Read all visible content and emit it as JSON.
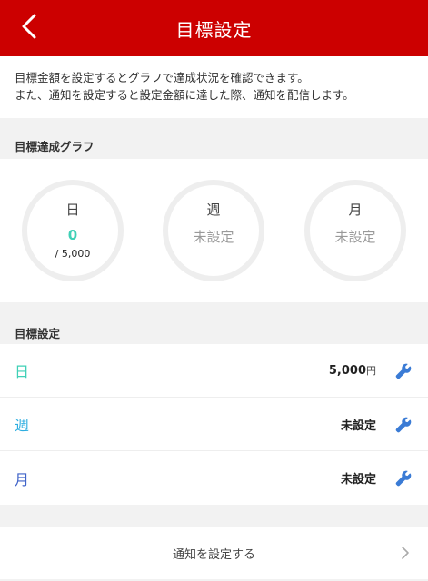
{
  "header": {
    "title": "目標設定",
    "back_icon": "chevron-left-icon"
  },
  "intro": {
    "line1": "目標金額を設定するとグラフで達成状況を確認できます。",
    "line2": "また、通知を設定すると設定金額に達した際、通知を配信します。"
  },
  "graph_section": {
    "label": "目標達成グラフ",
    "gauges": [
      {
        "period": "日",
        "value": "0",
        "target": "/ 5,000",
        "progress": 0
      },
      {
        "period": "週",
        "value": "未設定"
      },
      {
        "period": "月",
        "value": "未設定"
      }
    ]
  },
  "settings_section": {
    "label": "目標設定",
    "rows": [
      {
        "period": "日",
        "amount": "5,000",
        "unit": "円",
        "color": "#3fd0b6"
      },
      {
        "period": "週",
        "amount": "未設定",
        "unit": "",
        "color": "#2eaee0"
      },
      {
        "period": "月",
        "amount": "未設定",
        "unit": "",
        "color": "#3f63c8"
      }
    ],
    "edit_icon": "wrench-icon"
  },
  "notify": {
    "label": "通知を設定する",
    "icon": "chevron-right-icon"
  },
  "colors": {
    "header_bg": "#cc0000",
    "accent_teal": "#3fd0b6",
    "accent_sky": "#2eaee0",
    "accent_blue": "#3f63c8",
    "wrench_blue": "#3a7bd5"
  }
}
